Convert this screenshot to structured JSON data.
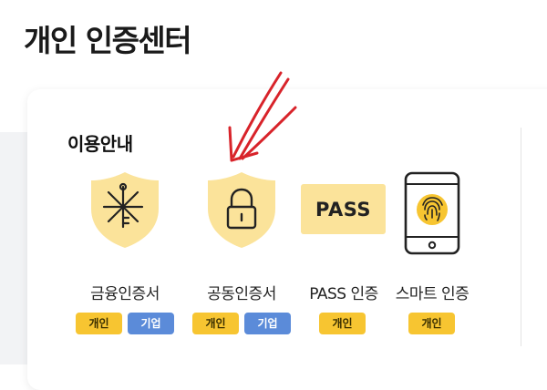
{
  "page": {
    "title": "개인 인증센터"
  },
  "section": {
    "title": "이용안내"
  },
  "items": [
    {
      "label": "금융인증서",
      "icon": "key-shield-icon",
      "tags": [
        "개인",
        "기업"
      ]
    },
    {
      "label": "공동인증서",
      "icon": "lock-shield-icon",
      "tags": [
        "개인",
        "기업"
      ]
    },
    {
      "label": "PASS 인증",
      "icon": "pass-logo-icon",
      "logo_text": "PASS",
      "tags": [
        "개인"
      ]
    },
    {
      "label": "스마트 인증",
      "icon": "fingerprint-phone-icon",
      "tags": [
        "개인"
      ]
    }
  ],
  "annotation": {
    "icon": "red-arrow-icon",
    "color": "#d8232a"
  },
  "colors": {
    "shield": "#fbe39a",
    "personal_tag": "#f7c531",
    "business_tag": "#5b8bd9"
  }
}
